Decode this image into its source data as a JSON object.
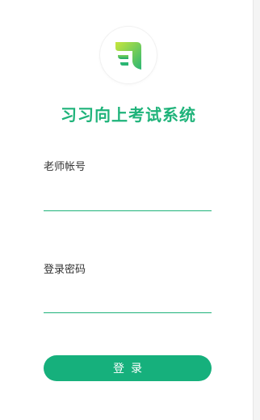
{
  "app": {
    "title": "习习向上考试系统",
    "logo_icon": "brand-logo-icon"
  },
  "form": {
    "account_label": "老师帐号",
    "account_value": "",
    "password_label": "登录密码",
    "password_value": "",
    "login_label": "登录"
  },
  "colors": {
    "accent": "#1fb37a",
    "button": "#16b07c"
  }
}
